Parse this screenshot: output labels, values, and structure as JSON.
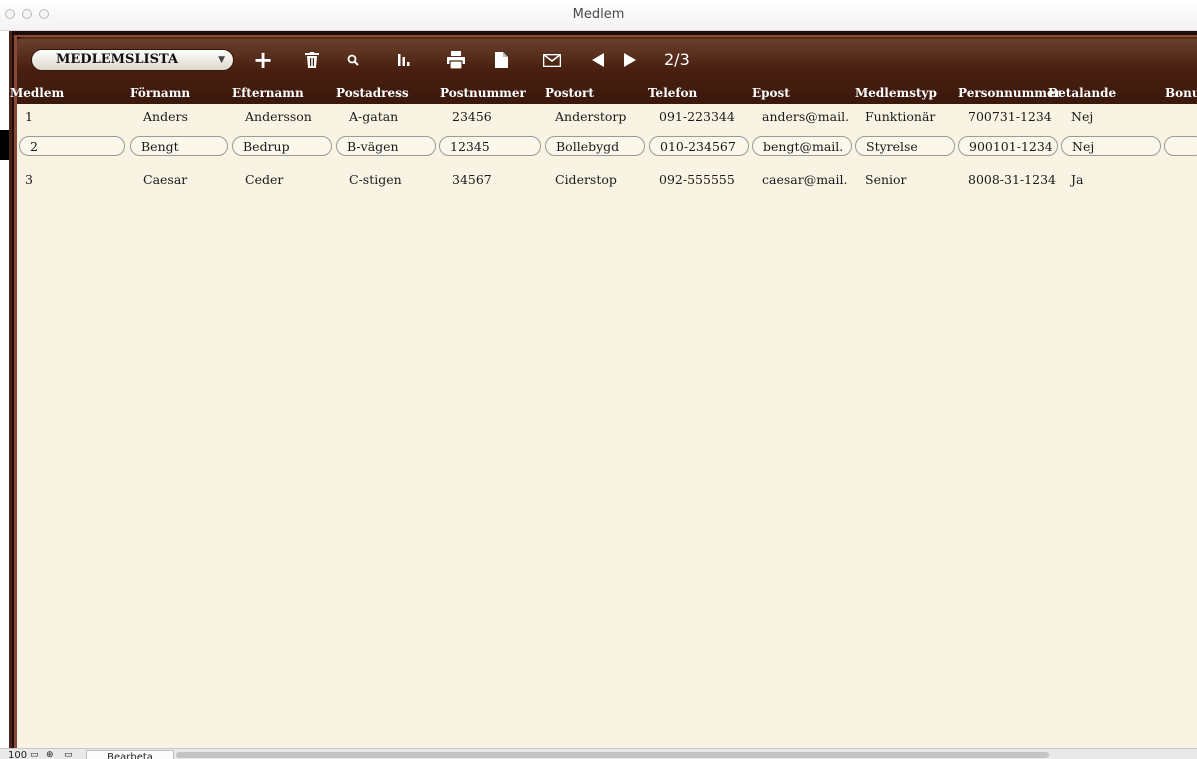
{
  "window": {
    "title": "Medlem"
  },
  "toolbar": {
    "layout_label": "MEDLEMSLISTA",
    "icons": [
      "plus-icon",
      "trash-icon",
      "search-icon",
      "chart-icon",
      "print-icon",
      "document-icon",
      "mail-icon",
      "prev-icon",
      "next-icon"
    ],
    "record_position": "2/3"
  },
  "table": {
    "columns": [
      "Medlem",
      "Förnamn",
      "Efternamn",
      "Postadress",
      "Postnummer",
      "Postort",
      "Telefon",
      "Epost",
      "Medlemstyp",
      "Personnummer",
      "Betalande",
      "Bonu"
    ],
    "rows": [
      [
        "1",
        "Anders",
        "Andersson",
        "A-gatan",
        "23456",
        "Anderstorp",
        "091-223344",
        "anders@mail.",
        "Funktionär",
        "700731-1234",
        "Nej",
        ""
      ],
      [
        "2",
        "Bengt",
        "Bedrup",
        "B-vägen",
        "12345",
        "Bollebygd",
        "010-234567",
        "bengt@mail.",
        "Styrelse",
        "900101-1234",
        "Nej",
        ""
      ],
      [
        "3",
        "Caesar",
        "Ceder",
        "C-stigen",
        "34567",
        "Ciderstop",
        "092-555555",
        "caesar@mail.",
        "Senior",
        "8008-31-1234",
        "Ja",
        ""
      ]
    ],
    "active_row": 1
  },
  "statusbar": {
    "zoom": "100",
    "mode": "Bearbeta"
  },
  "colors": {
    "header_brown": "#4a2010",
    "content_bg": "#f8f3e3",
    "frame_dark": "#1e0e0b"
  }
}
